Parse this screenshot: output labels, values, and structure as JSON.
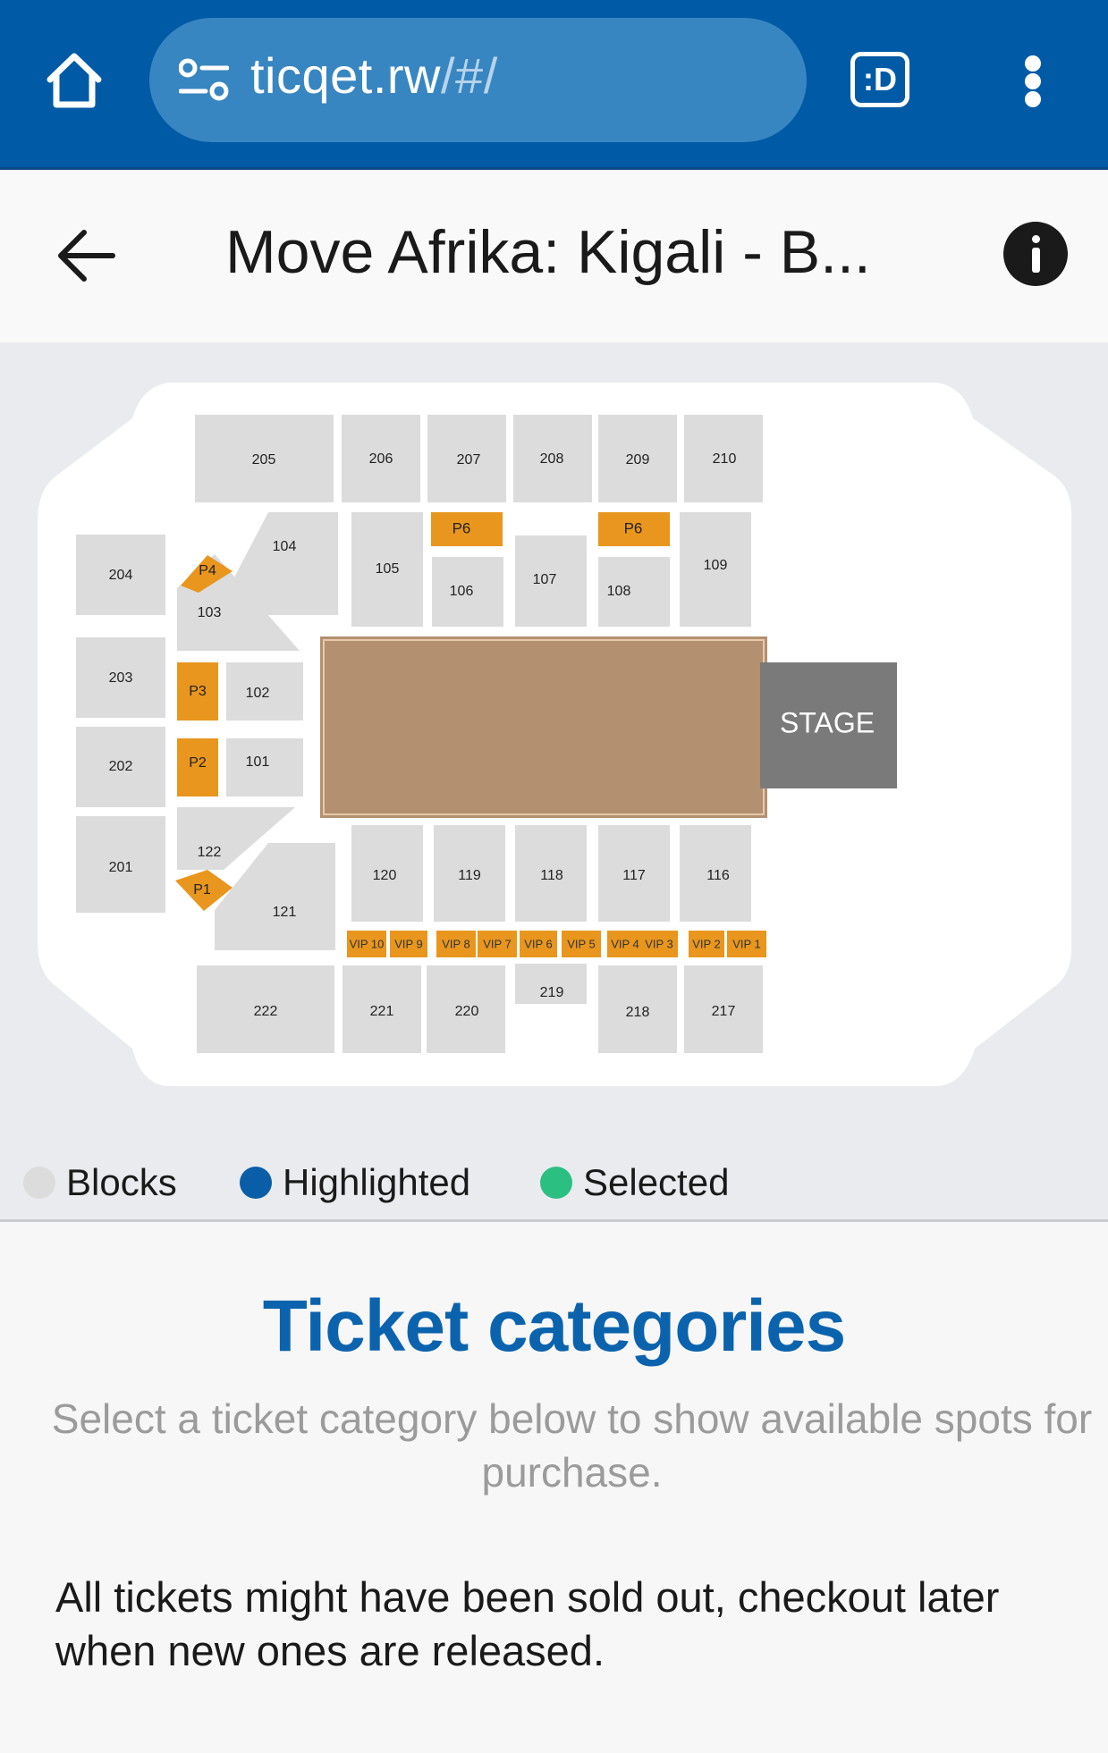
{
  "browser": {
    "url_host": "ticqet.rw",
    "url_path": "/#/",
    "extension_label": ":D"
  },
  "header": {
    "title": "Move Afrika: Kigali - B..."
  },
  "seat_map": {
    "stage_label": "STAGE",
    "blocks": [
      "205",
      "206",
      "207",
      "208",
      "209",
      "210",
      "204",
      "203",
      "202",
      "201",
      "104",
      "103",
      "105",
      "106",
      "107",
      "108",
      "109",
      "102",
      "101",
      "122",
      "121",
      "120",
      "119",
      "118",
      "117",
      "116",
      "219",
      "222",
      "221",
      "220",
      "218",
      "217"
    ],
    "premium": [
      "P6",
      "P6",
      "P4",
      "P3",
      "P2",
      "P1",
      "VIP 10",
      "VIP 9",
      "VIP 8",
      "VIP 7",
      "VIP 6",
      "VIP 5",
      "VIP 4",
      "VIP 3",
      "VIP 2",
      "VIP 1"
    ]
  },
  "legend": [
    {
      "label": "Blocks",
      "color": "#dcdcdc"
    },
    {
      "label": "Highlighted",
      "color": "#0a5ea8"
    },
    {
      "label": "Selected",
      "color": "#2bbf82"
    }
  ],
  "tickets": {
    "title": "Ticket categories",
    "subtitle": "Select a ticket category below to show available spots for purchase.",
    "note": "All tickets might have been sold out, checkout later when new ones are released."
  },
  "colors": {
    "browser_bar": "#015aa6",
    "block": "#dcdcdc",
    "premium": "#e8961e",
    "floor": "#b39170",
    "stage": "#7a7a7a",
    "title_blue": "#0b63ad"
  }
}
